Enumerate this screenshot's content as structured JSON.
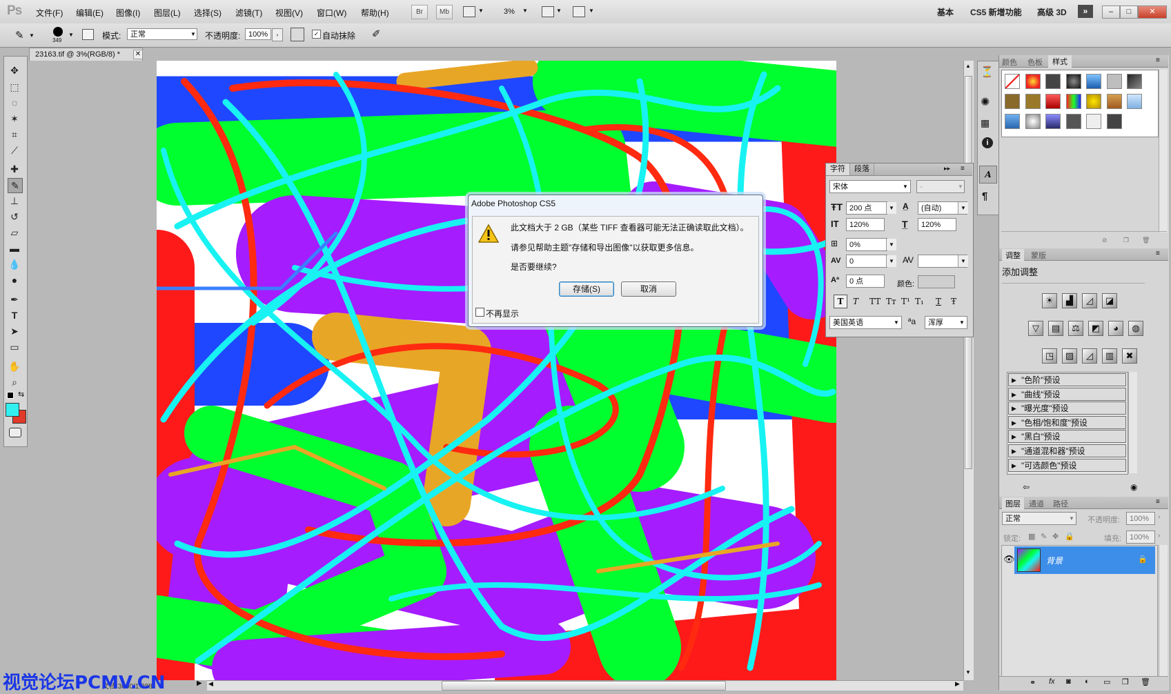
{
  "app": {
    "logo": "Ps"
  },
  "menu": [
    "文件(F)",
    "编辑(E)",
    "图像(I)",
    "图层(L)",
    "选择(S)",
    "滤镜(T)",
    "视图(V)",
    "窗口(W)",
    "帮助(H)"
  ],
  "appbar": {
    "br": "Br",
    "mb": "Mb",
    "zoom": "3%"
  },
  "workspaces": [
    "基本",
    "CS5 新增功能",
    "高级 3D"
  ],
  "options": {
    "brush_size": "349",
    "mode_label": "模式:",
    "mode_value": "正常",
    "opacity_label": "不透明度:",
    "opacity_value": "100%",
    "auto_erase_label": "自动抹除"
  },
  "document": {
    "tab_title": "23163.tif @ 3%(RGB/8) *",
    "status": "文档:3000/1.888"
  },
  "char_panel": {
    "tabs": [
      "字符",
      "段落"
    ],
    "font": "宋体",
    "style": "-",
    "size": "200 点",
    "leading": "(自动)",
    "vscale": "120%",
    "hscale": "120%",
    "tsume": "0%",
    "kerning": "0",
    "tracking": "",
    "baseline": "0 点",
    "color_label": "颜色:",
    "typebuttons": [
      "T",
      "T",
      "TT",
      "Tт",
      "T¹",
      "T₁",
      "T",
      "Ŧ"
    ],
    "language": "美国英语",
    "aa_label": "ªa",
    "aa_value": "浑厚"
  },
  "swatch_panel": {
    "tabs": [
      "颜色",
      "色板",
      "样式"
    ]
  },
  "adjust_panel": {
    "tabs": [
      "调整",
      "蒙版"
    ],
    "title": "添加调整",
    "presets": [
      "\"色阶\"预设",
      "\"曲线\"预设",
      "\"曝光度\"预设",
      "\"色相/饱和度\"预设",
      "\"黑白\"预设",
      "\"通道混和器\"预设",
      "\"可选颜色\"预设"
    ]
  },
  "layers_panel": {
    "tabs": [
      "图层",
      "通道",
      "路径"
    ],
    "blend": "正常",
    "opacity_label": "不透明度:",
    "opacity": "100%",
    "lock_label": "锁定:",
    "fill_label": "填充:",
    "fill": "100%",
    "layer_name": "背景"
  },
  "dialog": {
    "title": "Adobe Photoshop CS5",
    "line1": "此文档大于 2 GB（某些 TIFF 查看器可能无法正确读取此文档）。",
    "line2": "请参见帮助主题\"存储和导出图像\"以获取更多信息。",
    "line3": "是否要继续?",
    "save": "存储(S)",
    "cancel": "取消",
    "dont_show": "不再显示"
  },
  "watermark": "视觉论坛PCMV.CN",
  "colors": {
    "selection": "#3d8ee8",
    "dialog_frame": "#c8dcf5",
    "foreground": "#33f0f0",
    "background": "#e23a2a"
  }
}
